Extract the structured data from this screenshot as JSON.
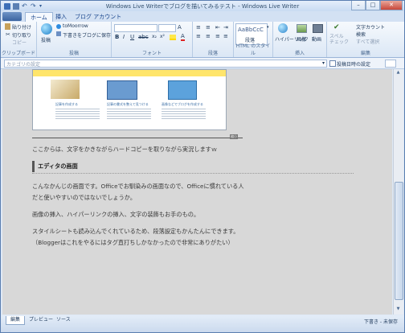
{
  "window": {
    "title": "Windows Live Writerでブログを描いてみるテスト - Windows Live Writer"
  },
  "tabs": [
    {
      "label": "ホーム"
    },
    {
      "label": "挿入"
    },
    {
      "label": "ブログ アカウント"
    }
  ],
  "ribbon": {
    "clipboard": {
      "paste": "貼り付け",
      "cut": "切り取り",
      "copy": "コピー",
      "group": "クリップボード"
    },
    "publish": {
      "publish": "投稿",
      "blog": "toMoorrow",
      "draft": "下書きをブログに保存",
      "group": "投稿"
    },
    "font": {
      "group": "フォント"
    },
    "paragraph": {
      "group": "段落"
    },
    "html_style": {
      "preview": "AaBbCcC",
      "name": "段落",
      "group": "HTML のスタイル"
    },
    "insert": {
      "hyperlink": "ハイパーリンク",
      "image": "画像",
      "video": "動画",
      "group": "挿入"
    },
    "edit": {
      "spell": "スペル チェック",
      "wordcount": "文字カウント",
      "find": "検索",
      "selectall": "すべて選択",
      "group": "編集"
    }
  },
  "category_bar": {
    "category_placeholder": "カテゴリの設定",
    "date_label": "投稿日時の設定"
  },
  "editor": {
    "thumbs": [
      {
        "caption": "記事を作成する"
      },
      {
        "caption": "記事の書式を整えて見つける"
      },
      {
        "caption": "画像などでブログを作成する"
      }
    ],
    "image_tag": "縮小",
    "paragraphs": {
      "p1": "ここからは、文字をかきながらハードコピーを取りながら実況しますｗ",
      "heading": "エディタの画面",
      "p2a": "こんなかんじの画面です。Officeでお馴染みの画面なので、Officeに慣れている人",
      "p2b": "だと使いやすいのではないでしょうか。",
      "p3": "画像の挿入、ハイパーリンクの挿入、文字の装飾もお手のもの。",
      "p4a": "スタイルシートも読み込んでくれているため、段落設定もかんたんにできます。",
      "p4b": "（Bloggerはこれをやるにはタグ直打ちしかなかったので非常にありがたい）"
    }
  },
  "status": {
    "tabs": [
      {
        "label": "編集"
      },
      {
        "label": "プレビュー"
      },
      {
        "label": "ソース"
      }
    ],
    "state": "下書き - 未保存"
  }
}
